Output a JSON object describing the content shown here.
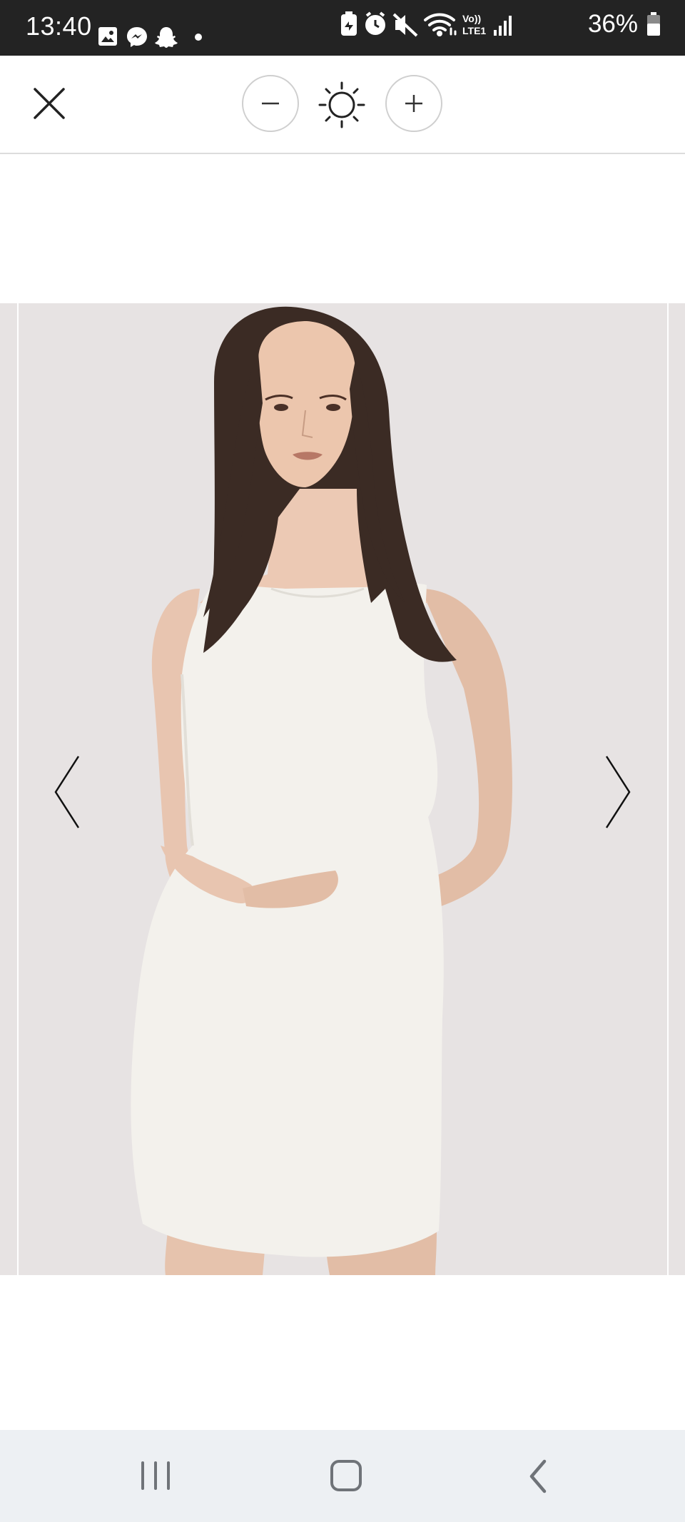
{
  "status_bar": {
    "time": "13:40",
    "battery_percent": "36%",
    "left_icons": [
      "gallery-icon",
      "messenger-icon",
      "snapchat-icon",
      "dot-icon"
    ],
    "right_icons": [
      "battery-saver-icon",
      "alarm-icon",
      "mute-icon",
      "wifi-icon",
      "volte-icon",
      "signal-icon",
      "battery-icon"
    ],
    "volte_label_1": "Vo))",
    "volte_label_2": "LTE1"
  },
  "toolbar": {
    "close_icon": "close-icon",
    "zoom_out_icon": "minus-icon",
    "brightness_icon": "sun-icon",
    "zoom_in_icon": "plus-icon"
  },
  "viewer": {
    "background_color": "#e7e3e3",
    "image_subject": "product-photo",
    "prev_icon": "chevron-left-icon",
    "next_icon": "chevron-right-icon"
  },
  "nav_bar": {
    "recents_icon": "recents-icon",
    "home_icon": "home-icon",
    "back_icon": "back-icon"
  }
}
